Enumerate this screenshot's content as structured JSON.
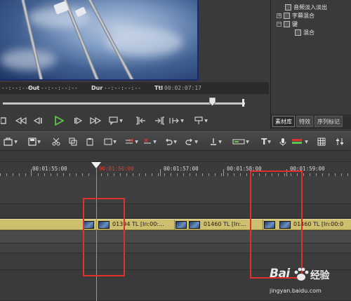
{
  "timecode_bar": {
    "in_value": "--:--:--:--",
    "out_label": "Out",
    "out_value": "--:--:--:--",
    "dur_label": "Dur",
    "dur_value": "--:--:--:--",
    "ttl_label": "Ttl",
    "ttl_value": "00:02:07:17"
  },
  "asset_tree": {
    "items": [
      {
        "label": "音频淡入淡出"
      },
      {
        "label": "字幕混合"
      },
      {
        "label": "键"
      },
      {
        "label": "混合"
      }
    ]
  },
  "panel_tabs": [
    {
      "label": "素材库",
      "active": true
    },
    {
      "label": "特效",
      "active": false
    },
    {
      "label": "序列标记",
      "active": false
    }
  ],
  "ruler": {
    "labels": [
      "00:01:55:00",
      "00:01:56:00",
      "00:01:57:00",
      "00:01:58:00",
      "00:01:59:00"
    ],
    "current_index": 1
  },
  "clips": [
    {
      "text": "01394  TL [In:00:..."
    },
    {
      "text": "01460  TL [In:..."
    },
    {
      "text": "01460  TL [In:00:0"
    }
  ],
  "watermark": {
    "brand": "Bai",
    "brand_suffix": "经验",
    "url": "jingyan.baidu.com"
  },
  "colors": {
    "clip_track": "#cdbf6e",
    "playhead": "#5aa8d8",
    "highlight_box": "#e0302c",
    "play_green": "#5fc24a"
  }
}
